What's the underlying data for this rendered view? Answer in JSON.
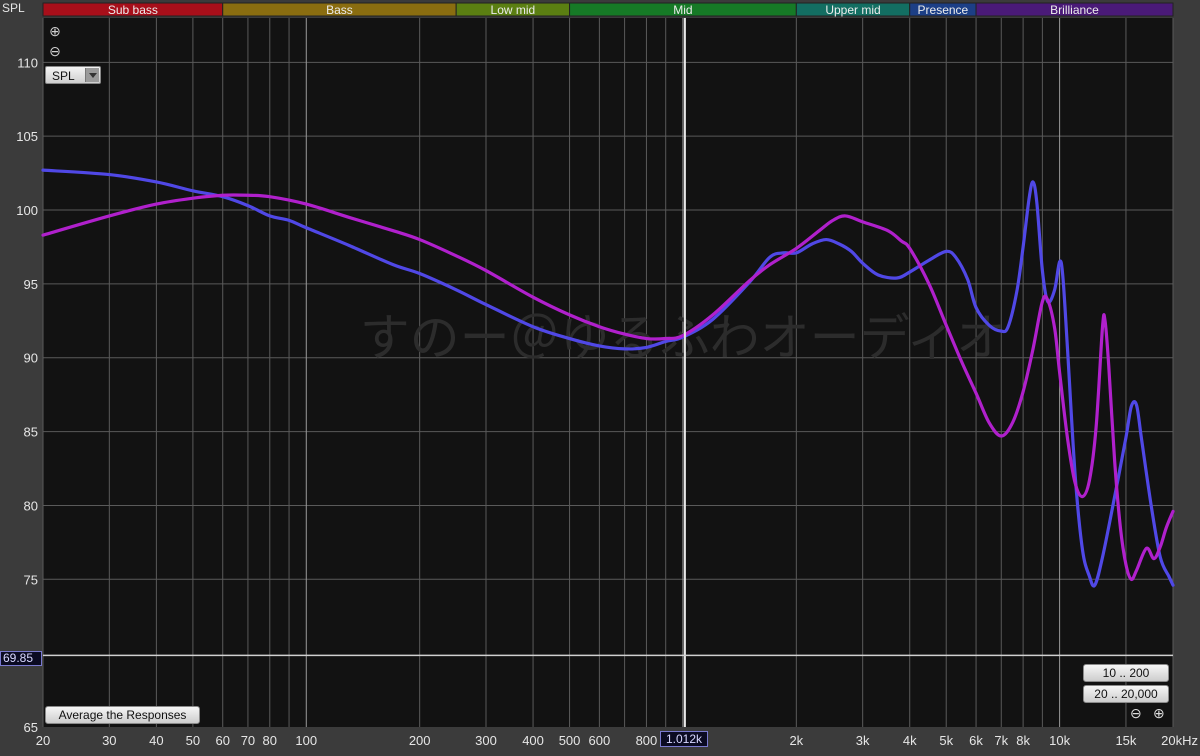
{
  "colors": {
    "plot_bg": "#121212",
    "grid": "#5a5a5a",
    "series_blue": "#5048e6",
    "series_magenta": "#b020cc"
  },
  "toolbar": {
    "axis_label": "SPL",
    "zoom_in_icon": "zoom-in-icon",
    "zoom_out_icon": "zoom-out-icon",
    "select_value": "SPL"
  },
  "bands": [
    {
      "label": "Sub bass",
      "color": "#a80f1a",
      "from": 20,
      "to": 60
    },
    {
      "label": "Bass",
      "color": "#8a6d10",
      "from": 60,
      "to": 250
    },
    {
      "label": "Low mid",
      "color": "#5b7f12",
      "from": 250,
      "to": 500
    },
    {
      "label": "Mid",
      "color": "#167a26",
      "from": 500,
      "to": 2000
    },
    {
      "label": "Upper mid",
      "color": "#136e62",
      "from": 2000,
      "to": 4000
    },
    {
      "label": "Presence",
      "color": "#1c3f86",
      "from": 4000,
      "to": 6000
    },
    {
      "label": "Brilliance",
      "color": "#4a1a78",
      "from": 6000,
      "to": 20000
    }
  ],
  "readouts": {
    "min_value": "69.85",
    "cursor_freq": "1.012k"
  },
  "buttons": {
    "average": "Average the Responses",
    "range_10_200": "10 .. 200",
    "range_20_20000": "20 .. 20,000"
  },
  "watermark": "すのー＠ゆるふわオーディオ",
  "chart_data": {
    "type": "line",
    "xscale": "log",
    "xlim": [
      20,
      20000
    ],
    "ylim": [
      65,
      113
    ],
    "cursor_x": 1012,
    "min_line_y": 69.85,
    "yticks": [
      65,
      75,
      80,
      85,
      90,
      95,
      100,
      105,
      110
    ],
    "ytick_labels": [
      "65",
      "75",
      "80",
      "85",
      "90",
      "95",
      "100",
      "105",
      "110"
    ],
    "xticks": [
      20,
      30,
      40,
      50,
      60,
      70,
      80,
      100,
      200,
      300,
      400,
      500,
      600,
      800,
      2000,
      3000,
      4000,
      5000,
      6000,
      7000,
      8000,
      10000,
      15000,
      20000
    ],
    "xtick_labels": [
      "20",
      "30",
      "40",
      "50",
      "60",
      "70",
      "80",
      "100",
      "200",
      "300",
      "400",
      "500",
      "600",
      "800",
      "2k",
      "3k",
      "4k",
      "5k",
      "6k",
      "7k",
      "8k",
      "10k",
      "15k",
      "20kHz"
    ],
    "minor_xgrid": [
      90,
      700,
      900,
      9000
    ],
    "series": [
      {
        "color": "#5048e6",
        "points": [
          [
            20,
            102.7
          ],
          [
            30,
            102.4
          ],
          [
            40,
            101.9
          ],
          [
            50,
            101.3
          ],
          [
            60,
            100.9
          ],
          [
            70,
            100.3
          ],
          [
            80,
            99.6
          ],
          [
            90,
            99.3
          ],
          [
            100,
            98.8
          ],
          [
            130,
            97.6
          ],
          [
            170,
            96.3
          ],
          [
            200,
            95.7
          ],
          [
            250,
            94.6
          ],
          [
            300,
            93.6
          ],
          [
            400,
            92.1
          ],
          [
            500,
            91.3
          ],
          [
            600,
            90.8
          ],
          [
            700,
            90.6
          ],
          [
            800,
            90.7
          ],
          [
            900,
            91.1
          ],
          [
            1000,
            91.4
          ],
          [
            1200,
            92.6
          ],
          [
            1500,
            95.1
          ],
          [
            1700,
            96.8
          ],
          [
            1850,
            97.1
          ],
          [
            2000,
            97.1
          ],
          [
            2200,
            97.7
          ],
          [
            2400,
            98.0
          ],
          [
            2600,
            97.7
          ],
          [
            2800,
            97.2
          ],
          [
            3000,
            96.4
          ],
          [
            3300,
            95.6
          ],
          [
            3700,
            95.4
          ],
          [
            4000,
            95.8
          ],
          [
            4500,
            96.6
          ],
          [
            5000,
            97.2
          ],
          [
            5300,
            96.8
          ],
          [
            5700,
            95.3
          ],
          [
            6000,
            93.4
          ],
          [
            6500,
            92.2
          ],
          [
            7000,
            91.8
          ],
          [
            7300,
            92.1
          ],
          [
            7700,
            94.5
          ],
          [
            8000,
            97.5
          ],
          [
            8300,
            100.8
          ],
          [
            8500,
            101.9
          ],
          [
            8700,
            100.5
          ],
          [
            9000,
            95.9
          ],
          [
            9300,
            93.8
          ],
          [
            9700,
            94.6
          ],
          [
            10000,
            96.5
          ],
          [
            10200,
            95.5
          ],
          [
            10500,
            90.5
          ],
          [
            11000,
            82.0
          ],
          [
            11500,
            77.0
          ],
          [
            12000,
            75.2
          ],
          [
            12400,
            74.6
          ],
          [
            13000,
            76.5
          ],
          [
            14000,
            80.6
          ],
          [
            15000,
            84.6
          ],
          [
            15500,
            86.7
          ],
          [
            16000,
            86.8
          ],
          [
            16500,
            84.5
          ],
          [
            17500,
            80.0
          ],
          [
            18500,
            76.5
          ],
          [
            19500,
            75.2
          ],
          [
            20000,
            74.6
          ]
        ]
      },
      {
        "color": "#b020cc",
        "points": [
          [
            20,
            98.3
          ],
          [
            30,
            99.6
          ],
          [
            40,
            100.4
          ],
          [
            50,
            100.8
          ],
          [
            60,
            101.0
          ],
          [
            70,
            101.0
          ],
          [
            80,
            100.9
          ],
          [
            100,
            100.4
          ],
          [
            130,
            99.5
          ],
          [
            170,
            98.6
          ],
          [
            200,
            98.0
          ],
          [
            250,
            96.9
          ],
          [
            300,
            95.9
          ],
          [
            400,
            94.1
          ],
          [
            500,
            92.9
          ],
          [
            600,
            92.1
          ],
          [
            700,
            91.6
          ],
          [
            800,
            91.3
          ],
          [
            900,
            91.3
          ],
          [
            1000,
            91.5
          ],
          [
            1200,
            92.9
          ],
          [
            1500,
            95.2
          ],
          [
            1700,
            96.3
          ],
          [
            2000,
            97.4
          ],
          [
            2300,
            98.6
          ],
          [
            2500,
            99.3
          ],
          [
            2700,
            99.6
          ],
          [
            3000,
            99.2
          ],
          [
            3500,
            98.6
          ],
          [
            3800,
            97.9
          ],
          [
            4000,
            97.4
          ],
          [
            4500,
            95.0
          ],
          [
            5000,
            92.2
          ],
          [
            5500,
            89.7
          ],
          [
            6000,
            87.6
          ],
          [
            6500,
            85.6
          ],
          [
            7000,
            84.7
          ],
          [
            7500,
            85.6
          ],
          [
            8000,
            87.7
          ],
          [
            8500,
            90.6
          ],
          [
            9000,
            93.8
          ],
          [
            9300,
            93.9
          ],
          [
            9700,
            92.0
          ],
          [
            10000,
            89.0
          ],
          [
            10500,
            84.5
          ],
          [
            11000,
            81.5
          ],
          [
            11500,
            80.6
          ],
          [
            12000,
            81.7
          ],
          [
            12500,
            85.3
          ],
          [
            13000,
            92.1
          ],
          [
            13200,
            92.5
          ],
          [
            13500,
            89.5
          ],
          [
            14000,
            83.0
          ],
          [
            14500,
            78.5
          ],
          [
            15000,
            76.0
          ],
          [
            15500,
            75.0
          ],
          [
            16000,
            75.6
          ],
          [
            17000,
            77.1
          ],
          [
            17800,
            76.4
          ],
          [
            18500,
            77.2
          ],
          [
            19200,
            78.5
          ],
          [
            20000,
            79.6
          ]
        ]
      }
    ]
  }
}
